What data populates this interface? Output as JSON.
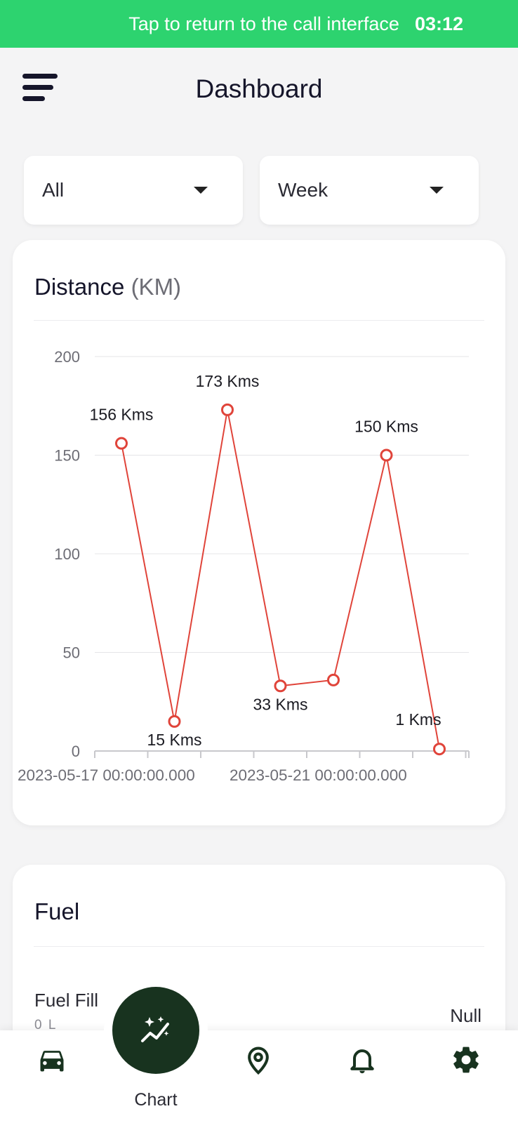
{
  "call_banner": {
    "message": "Tap to return to the call interface",
    "time": "03:12",
    "color": "#2dd36f"
  },
  "header": {
    "title": "Dashboard",
    "menu_icon": "menu-icon"
  },
  "filters": [
    {
      "value": "All",
      "icon": "caret-down-icon"
    },
    {
      "value": "Week",
      "icon": "caret-down-icon"
    }
  ],
  "distance_card": {
    "title": "Distance",
    "unit": "(KM)"
  },
  "chart_data": {
    "type": "line",
    "title": "Distance (KM)",
    "color": "#e0443a",
    "ylim": [
      0,
      200
    ],
    "yticks": [
      0,
      50,
      100,
      150,
      200
    ],
    "grid": true,
    "x_tick_labels": [
      "2023-05-17 00:00:00.000",
      "2023-05-21 00:00:00.000"
    ],
    "series": [
      {
        "values": [
          156,
          15,
          173,
          33,
          36,
          150,
          1
        ],
        "labels": [
          "156 Kms",
          "15 Kms",
          "173 Kms",
          "33 Kms",
          "",
          "150 Kms",
          "1 Kms"
        ]
      }
    ]
  },
  "fuel_card": {
    "title": "Fuel",
    "row_label": "Fuel Fill",
    "row_value": "0 L",
    "row_status": "Null"
  },
  "bottom_nav": {
    "items": [
      {
        "icon": "car-icon"
      },
      {
        "icon": "location-pin-icon"
      },
      {
        "icon": "bell-icon"
      },
      {
        "icon": "gear-icon"
      }
    ],
    "fab": {
      "label": "Chart",
      "icon": "chart-sparkle-icon",
      "color": "#18331f"
    }
  }
}
